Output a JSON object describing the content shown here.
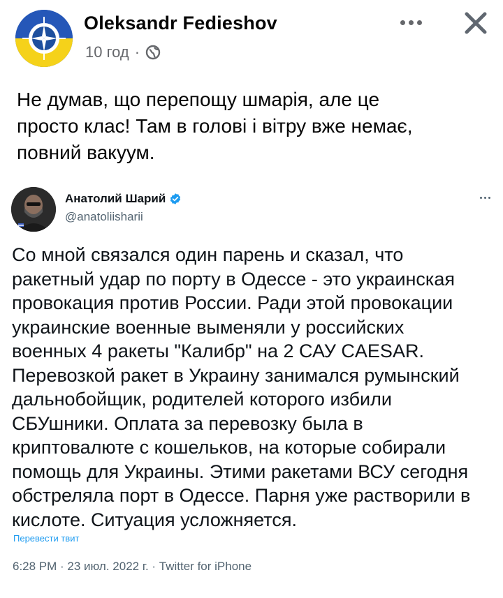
{
  "post": {
    "author": "Oleksandr Fedieshov",
    "time": "10 год",
    "dot": "·",
    "text_lines": [
      "Не думав, що перепощу шмарія, але це",
      "просто клас! Там в голові і вітру вже немає,",
      "повний вакуум."
    ],
    "icons": {
      "privacy": "globe-icon",
      "menu": "more-icon",
      "close": "close-icon"
    }
  },
  "tweet": {
    "author": "Анатолий Шарий",
    "handle": "@anatoliisharii",
    "text_lines": [
      "Со мной связался один парень и сказал, что",
      "ракетный удар по порту в Одессе - это украинская",
      "провокация против России. Ради этой провокации",
      "украинские военные выменяли у российских",
      "военных 4 ракеты \"Калибр\" на 2 САУ CAESAR.",
      "Перевозкой ракет в Украину занимался румынский",
      "дальнобойщик, родителей которого избили",
      "СБУшники. Оплата за перевозку была в",
      "криптовалюте с кошельков, на которые собирали",
      "помощь для Украины. Этими ракетами ВСУ сегодня",
      "обстреляла порт в Одессе. Парня уже растворили в",
      "кислоте. Ситуация усложняется."
    ],
    "translate_label": "Перевести твит",
    "footer": "6:28 PM · 23 июл. 2022 г. · Twitter for iPhone",
    "icons": {
      "verified": "verified-badge-icon",
      "menu": "more-icon"
    }
  },
  "colors": {
    "text_primary": "#050505",
    "text_secondary": "#65676b",
    "tweet_text": "#0f1419",
    "tweet_secondary": "#536471",
    "link_blue": "#1d9bf0"
  }
}
